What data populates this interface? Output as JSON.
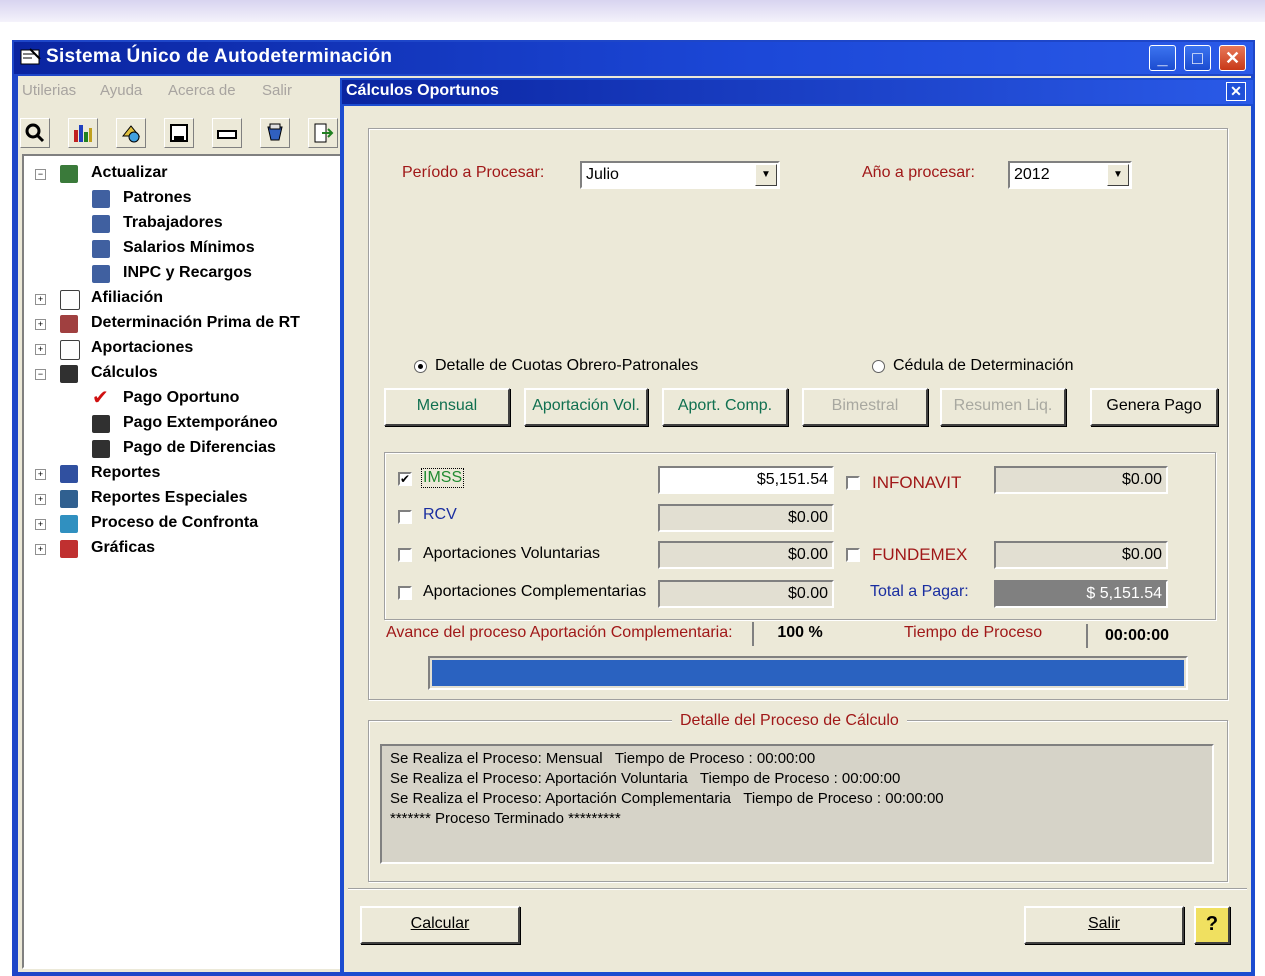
{
  "window": {
    "title": "Sistema Único de Autodeterminación",
    "controls": {
      "minimize": "_",
      "maximize": "□",
      "close": "✕"
    }
  },
  "menu": [
    "Utilerias",
    "Ayuda",
    "Acerca de",
    "Salir"
  ],
  "toolbar_icons": [
    "search-icon",
    "chart-icon",
    "shapes-icon",
    "floppy-icon",
    "drive-icon",
    "reports-icon",
    "exit-icon"
  ],
  "tree": {
    "items": [
      {
        "label": "Actualizar",
        "expander": "−"
      },
      {
        "label": "Patrones"
      },
      {
        "label": "Trabajadores"
      },
      {
        "label": "Salarios Mínimos"
      },
      {
        "label": "INPC y Recargos"
      },
      {
        "label": "Afiliación",
        "expander": "+"
      },
      {
        "label": "Determinación Prima de RT",
        "expander": "+"
      },
      {
        "label": "Aportaciones",
        "expander": "+"
      },
      {
        "label": "Cálculos",
        "expander": "−"
      },
      {
        "label": "Pago Oportuno"
      },
      {
        "label": "Pago Extemporáneo"
      },
      {
        "label": "Pago de Diferencias"
      },
      {
        "label": "Reportes",
        "expander": "+"
      },
      {
        "label": "Reportes Especiales",
        "expander": "+"
      },
      {
        "label": "Proceso de Confronta",
        "expander": "+"
      },
      {
        "label": "Gráficas",
        "expander": "+"
      }
    ]
  },
  "dialog": {
    "title": "Cálculos Oportunos",
    "close": "✕",
    "periodo_label": "Período a Procesar:",
    "periodo_value": "Julio",
    "anio_label": "Año a procesar:",
    "anio_value": "2012",
    "radio_detalle": "Detalle de Cuotas Obrero-Patronales",
    "radio_cedula": "Cédula de Determinación",
    "buttons": {
      "mensual": "Mensual",
      "aportacion_vol": "Aportación Vol.",
      "aport_comp": "Aport. Comp.",
      "bimestral": "Bimestral",
      "resumen_liq": "Resumen Liq.",
      "genera_pago": "Genera Pago"
    },
    "imss": {
      "label": "IMSS",
      "checked": "✔",
      "value": "$5,151.54"
    },
    "rcv": {
      "label": "RCV",
      "value": "$0.00"
    },
    "aport_vol": {
      "label": "Aportaciones Voluntarias",
      "value": "$0.00"
    },
    "aport_comp": {
      "label": "Aportaciones Complementarias",
      "value": "$0.00"
    },
    "infonavit": {
      "label": "INFONAVIT",
      "value": "$0.00"
    },
    "fundemex": {
      "label": "FUNDEMEX",
      "value": "$0.00"
    },
    "total": {
      "label": "Total a Pagar:",
      "value": "$ 5,151.54"
    },
    "avance_label": "Avance del proceso Aportación Complementaria:",
    "avance_value": "100 %",
    "tiempo_label": "Tiempo de Proceso",
    "tiempo_value": "00:00:00",
    "progress": 1.0,
    "detalle_title": "Detalle del Proceso de Cálculo",
    "log": [
      "Se Realiza el Proceso: Mensual   Tiempo de Proceso : 00:00:00",
      "Se Realiza el Proceso: Aportación Voluntaria   Tiempo de Proceso : 00:00:00",
      "Se Realiza el Proceso: Aportación Complementaria   Tiempo de Proceso : 00:00:00",
      "******* Proceso Terminado *********"
    ],
    "calcular": "Calcular",
    "salir": "Salir",
    "help": "?"
  },
  "colors": {
    "title_blue": "#0a24a0",
    "label_red": "#a01818",
    "label_blue": "#1a2ea0",
    "progress": "#2a62c0"
  }
}
